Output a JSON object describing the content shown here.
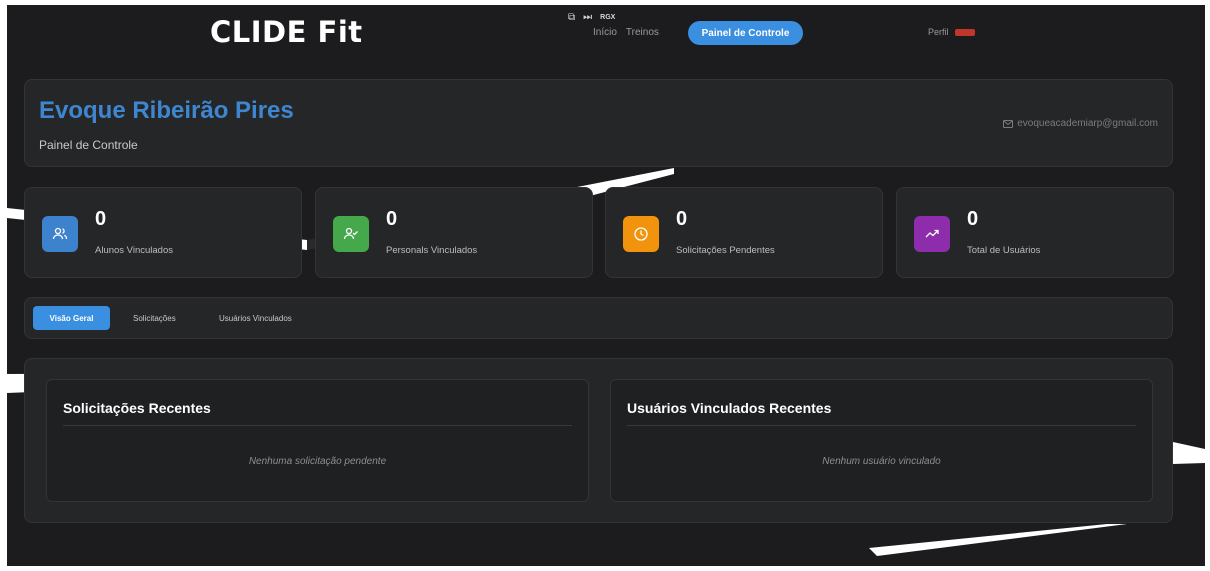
{
  "header": {
    "brand": "CLIDE Fit",
    "mini_icons": {
      "window_icon": "window-restore-icon",
      "skip_icon": "skip-forward-icon",
      "rgx_label": "RGX"
    },
    "nav": {
      "inicio": "Início",
      "treinos": "Treinos",
      "painel": "Painel de Controle"
    },
    "perfil_label": "Perfil"
  },
  "profile": {
    "name": "Evoque Ribeirão Pires",
    "subtitle": "Painel de Controle",
    "email": "evoqueacademiarp@gmail.com"
  },
  "stats": [
    {
      "value": "0",
      "label": "Alunos Vinculados",
      "icon": "users-icon",
      "color": "#3d82cc"
    },
    {
      "value": "0",
      "label": "Personals Vinculados",
      "icon": "user-check-icon",
      "color": "#45a84b"
    },
    {
      "value": "0",
      "label": "Solicitações Pendentes",
      "icon": "clock-icon",
      "color": "#f2930d"
    },
    {
      "value": "0",
      "label": "Total de Usuários",
      "icon": "trending-up-icon",
      "color": "#8e2dab"
    }
  ],
  "tabs": {
    "visao": "Visão Geral",
    "solicitacoes": "Solicitações",
    "usuarios": "Usuários Vinculados"
  },
  "panels": {
    "solicitacoes": {
      "title": "Solicitações Recentes",
      "empty": "Nenhuma solicitação pendente"
    },
    "usuarios": {
      "title": "Usuários Vinculados Recentes",
      "empty": "Nenhum usuário vinculado"
    }
  },
  "colors": {
    "accent": "#3a8fe0",
    "background": "#1c1c1e",
    "card": "#252628",
    "brand_name": "#3f86d0"
  }
}
